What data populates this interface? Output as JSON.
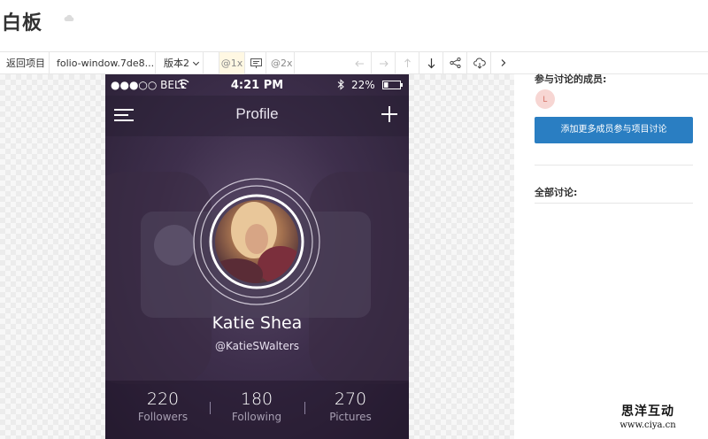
{
  "header": {
    "title": "白板"
  },
  "toolbar": {
    "back_label": "返回项目",
    "file_name": "folio-window.7de8...",
    "version_label": "版本2",
    "zoom_1x": "@1x",
    "zoom_2x": "@2x",
    "icons": [
      "comment-icon",
      "undo-icon",
      "redo-icon",
      "upload-icon",
      "download-icon",
      "share-icon",
      "cloud-download-icon",
      "chevron-right-icon"
    ]
  },
  "mockup": {
    "status": {
      "carrier": "●●●○○ BELL",
      "time": "4:21 PM",
      "battery": "22%"
    },
    "nav_title": "Profile",
    "name": "Katie Shea",
    "handle": "@KatieSWalters",
    "stats": [
      {
        "value": "220",
        "label": "Followers"
      },
      {
        "value": "180",
        "label": "Following"
      },
      {
        "value": "270",
        "label": "Pictures"
      }
    ]
  },
  "sidebar": {
    "members_title": "参与讨论的成员:",
    "member_initial": "L",
    "add_button": "添加更多成员参与项目讨论",
    "discussion_title": "全部讨论:"
  },
  "watermark": {
    "title": "思洋互动",
    "url": "www.ciya.cn"
  },
  "colors": {
    "accent": "#2a7ec2",
    "mockup_bg": "#3e2f4c",
    "zoom_active_bg": "#fff8e3",
    "member_avatar_bg": "#f7d6d3"
  }
}
